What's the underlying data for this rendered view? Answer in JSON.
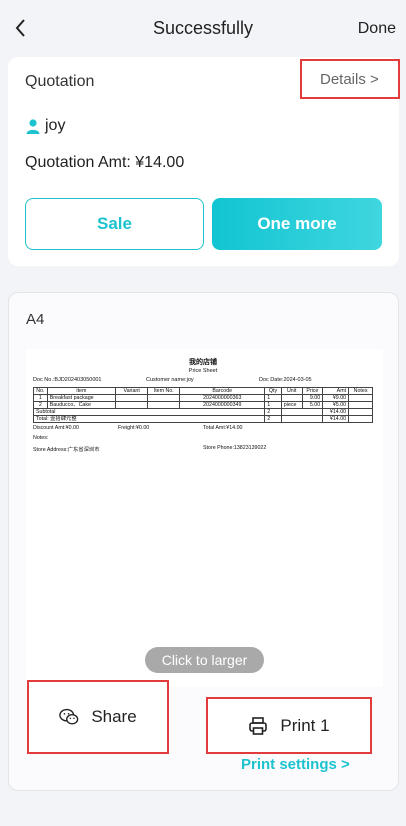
{
  "header": {
    "title": "Successfully",
    "done_label": "Done"
  },
  "quotation": {
    "title": "Quotation",
    "details_label": "Details >",
    "customer": "joy",
    "amount_text": "Quotation Amt: ¥14.00",
    "sale_label": "Sale",
    "one_more_label": "One more"
  },
  "preview": {
    "paper_label": "A4",
    "click_label": "Click to larger",
    "sheet": {
      "shop_name": "我的店铺",
      "subtitle": "Price Sheet",
      "doc_no": "Doc No.:BJD202403050001",
      "customer": "Customer name:joy",
      "doc_date": "Doc Date:2024-03-05",
      "columns": [
        "No.",
        "item",
        "Variant",
        "Item No.",
        "Barcode",
        "Qty",
        "Unit",
        "Price",
        "Amt",
        "Notes"
      ],
      "rows": [
        [
          "1",
          "Breakfast package",
          "",
          "",
          "2024000000363",
          "1",
          "",
          "9.00",
          "¥9.00",
          ""
        ],
        [
          "2",
          "Bauducco、Cake",
          "",
          "",
          "2024000000349",
          "1",
          "piece",
          "5.00",
          "¥5.00",
          ""
        ]
      ],
      "subtotal_label": "Subtotal",
      "subtotal_qty": "2",
      "subtotal_amt": "¥14.00",
      "total_label": "Total: 壹拾肆元整",
      "total_qty": "2",
      "total_amt": "¥14.00",
      "discount": "Discount Amt:¥0.00",
      "freight": "Freight:¥0.00",
      "total_amt_text": "Total Amt:¥14.00",
      "notes": "Notes:",
      "store_address": "Store Address:广东省深圳市",
      "store_phone": "Store Phone:13823139022"
    }
  },
  "actions": {
    "share_label": "Share",
    "print_label": "Print 1",
    "print_settings_label": "Print settings >"
  },
  "colors": {
    "accent": "#1cc3cf",
    "highlight_border": "#e23b3b"
  }
}
